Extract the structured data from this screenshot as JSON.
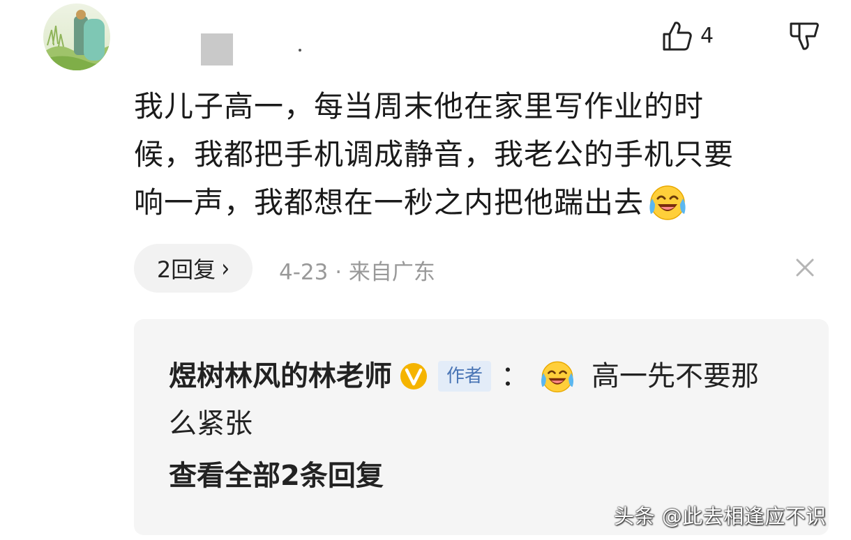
{
  "comment": {
    "likes": "4",
    "text_line1": "我儿子高一，每当周末他在家里写作业的时",
    "text_line2": "候，我都把手机调成静音，我老公的手机只要",
    "text_line3": "响一声，我都想在一秒之内把他踹出去",
    "emoji": "laughing-crying-emoji",
    "reply_count_label": "2回复",
    "meta": "4-23 · 来自广东"
  },
  "reply": {
    "author_name": "煜树林风的林老师",
    "author_tag": "作者",
    "colon": "：",
    "text_part1": "高一先不要那",
    "text_part2": "么紧张",
    "view_all": "查看全部2条回复"
  },
  "watermark": "头条 @此去相逢应不识",
  "colors": {
    "reply_bg": "#f5f5f5",
    "meta_gray": "#999999",
    "tag_blue": "#4a75b5",
    "badge_yellow": "#f5b400"
  }
}
